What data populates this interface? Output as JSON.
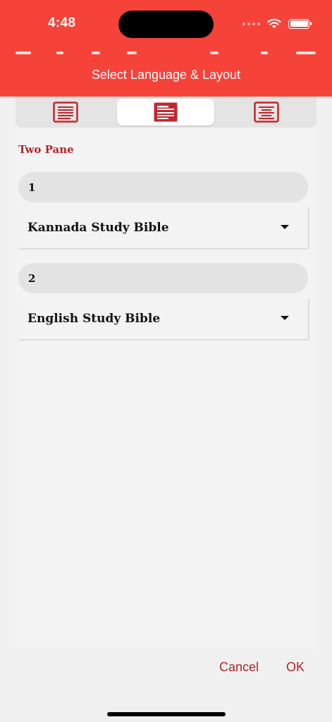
{
  "status_bar": {
    "time": "4:48"
  },
  "dialog": {
    "title": "Select Language & Layout"
  },
  "layouts": {
    "options": [
      {
        "name": "single-pane-layout-icon",
        "selected": false
      },
      {
        "name": "two-pane-layout-icon",
        "selected": true
      },
      {
        "name": "parallel-layout-icon",
        "selected": false
      }
    ],
    "selected_label": "Two Pane"
  },
  "panes": [
    {
      "number": "1",
      "language": "Kannada Study Bible"
    },
    {
      "number": "2",
      "language": "English Study Bible"
    }
  ],
  "buttons": {
    "cancel": "Cancel",
    "ok": "OK"
  },
  "colors": {
    "header": "#f6433a",
    "accent": "#b3262b"
  }
}
